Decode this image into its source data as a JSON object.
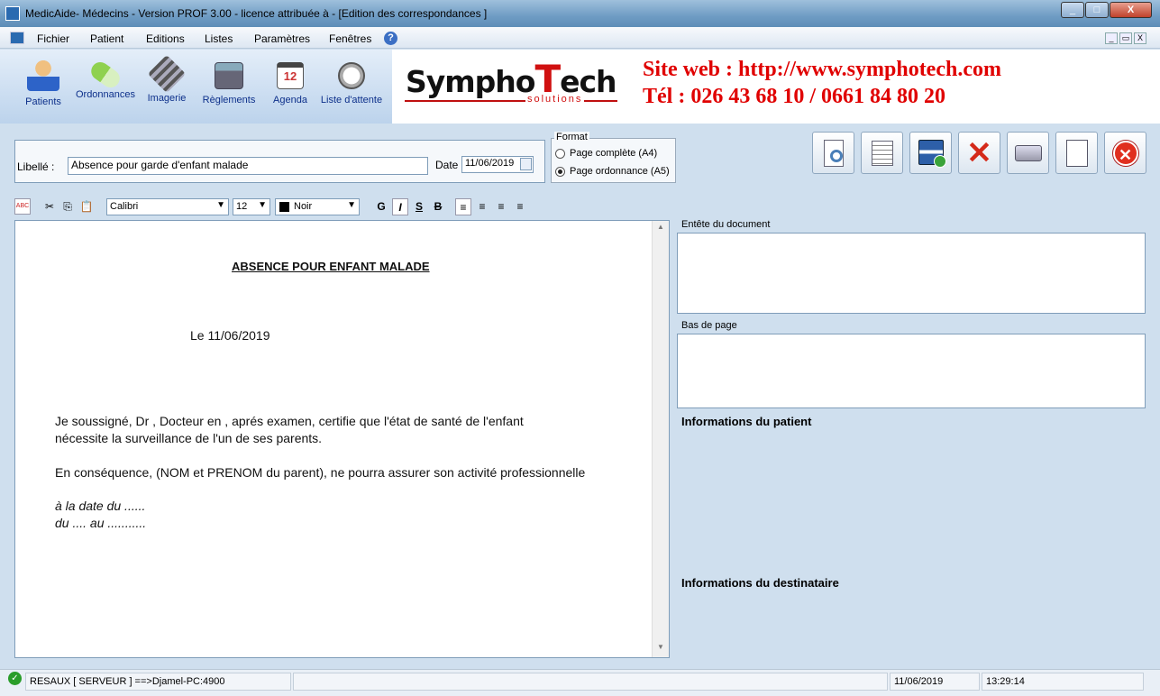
{
  "window": {
    "title": "MedicAide- Médecins - Version PROF 3.00 - licence attribuée à  - [Edition des correspondances  ]",
    "min": "_",
    "max": "□",
    "close": "X"
  },
  "menu": {
    "items": [
      "Fichier",
      "Patient",
      "Editions",
      "Listes",
      "Paramètres",
      "Fenêtres"
    ],
    "help_icon": "?",
    "mdi": [
      "_",
      "▭",
      "X"
    ]
  },
  "toolbar": {
    "buttons": [
      {
        "label": "Patients",
        "icon": "patient-icon"
      },
      {
        "label": "Ordonnances",
        "icon": "pill-icon"
      },
      {
        "label": "Imagerie",
        "icon": "film-icon"
      },
      {
        "label": "Règlements",
        "icon": "cash-register-icon"
      },
      {
        "label": "Agenda",
        "icon": "calendar-icon"
      },
      {
        "label": "Liste d'attente",
        "icon": "stopwatch-icon"
      }
    ],
    "calendar_day": "12"
  },
  "banner": {
    "logo_main": "Sympho",
    "logo_t": "T",
    "logo_end": "ech",
    "logo_sub": "solutions",
    "line1": "Site web : http://www.symphotech.com",
    "line2": "Tél : 026 43 68 10 / 0661 84 80 20"
  },
  "form": {
    "libelle_label": "Libellé :",
    "libelle_value": "Absence pour garde d'enfant malade",
    "date_label": "Date",
    "date_value": "11/06/2019"
  },
  "format": {
    "legend": "Format",
    "options": [
      {
        "label": "Page complète (A4)",
        "selected": false
      },
      {
        "label": "Page ordonnance (A5)",
        "selected": true
      }
    ]
  },
  "actions": [
    "preview-icon",
    "list-icon",
    "save-icon",
    "delete-icon",
    "print-icon",
    "new-document-icon",
    "close-icon"
  ],
  "formatting": {
    "font": "Calibri",
    "size": "12",
    "color": "Noir",
    "bold": "G",
    "italic": "I",
    "underline": "S",
    "strike": "B"
  },
  "document": {
    "title": "ABSENCE POUR ENFANT MALADE",
    "date_line": "Le  11/06/2019",
    "para1_line1": "Je soussigné, Dr   , Docteur en   , aprés examen, certifie que l'état de santé de l'enfant",
    "para1_line2": "nécessite la surveillance de l'un de ses parents.",
    "para2": "En conséquence, (NOM et PRENOM du parent), ne pourra assurer son activité professionnelle",
    "italic1": "à la date du ......",
    "italic2": "du .... au ..........."
  },
  "right_panel": {
    "header_label": "Entête du document",
    "footer_label": "Bas de page",
    "patient_info": "Informations du patient",
    "recipient_info": "Informations du destinataire"
  },
  "status": {
    "connection": "RESAUX [ SERVEUR ] ==>Djamel-PC:4900",
    "date": "11/06/2019",
    "time": "13:29:14"
  }
}
